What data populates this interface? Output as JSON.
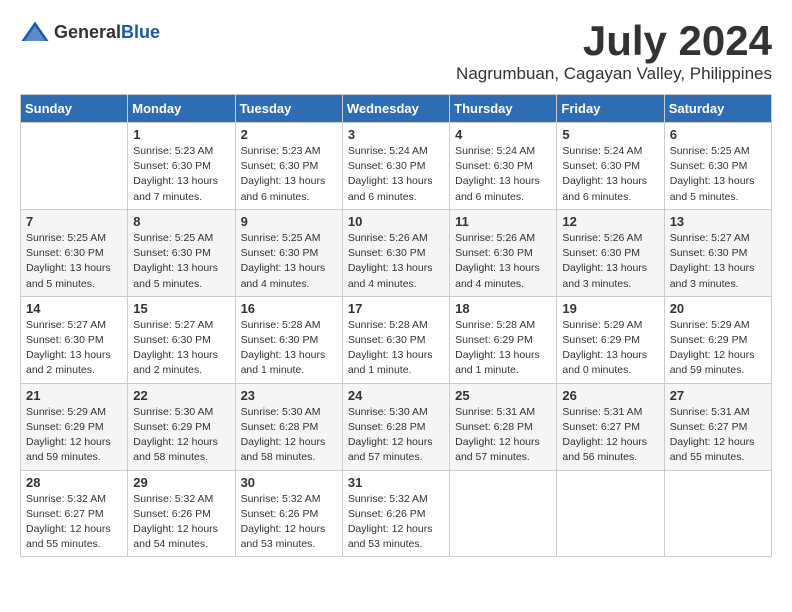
{
  "logo": {
    "general": "General",
    "blue": "Blue"
  },
  "title": {
    "month": "July 2024",
    "location": "Nagrumbuan, Cagayan Valley, Philippines"
  },
  "calendar": {
    "headers": [
      "Sunday",
      "Monday",
      "Tuesday",
      "Wednesday",
      "Thursday",
      "Friday",
      "Saturday"
    ],
    "rows": [
      [
        {
          "date": "",
          "info": ""
        },
        {
          "date": "1",
          "info": "Sunrise: 5:23 AM\nSunset: 6:30 PM\nDaylight: 13 hours\nand 7 minutes."
        },
        {
          "date": "2",
          "info": "Sunrise: 5:23 AM\nSunset: 6:30 PM\nDaylight: 13 hours\nand 6 minutes."
        },
        {
          "date": "3",
          "info": "Sunrise: 5:24 AM\nSunset: 6:30 PM\nDaylight: 13 hours\nand 6 minutes."
        },
        {
          "date": "4",
          "info": "Sunrise: 5:24 AM\nSunset: 6:30 PM\nDaylight: 13 hours\nand 6 minutes."
        },
        {
          "date": "5",
          "info": "Sunrise: 5:24 AM\nSunset: 6:30 PM\nDaylight: 13 hours\nand 6 minutes."
        },
        {
          "date": "6",
          "info": "Sunrise: 5:25 AM\nSunset: 6:30 PM\nDaylight: 13 hours\nand 5 minutes."
        }
      ],
      [
        {
          "date": "7",
          "info": "Sunrise: 5:25 AM\nSunset: 6:30 PM\nDaylight: 13 hours\nand 5 minutes."
        },
        {
          "date": "8",
          "info": "Sunrise: 5:25 AM\nSunset: 6:30 PM\nDaylight: 13 hours\nand 5 minutes."
        },
        {
          "date": "9",
          "info": "Sunrise: 5:25 AM\nSunset: 6:30 PM\nDaylight: 13 hours\nand 4 minutes."
        },
        {
          "date": "10",
          "info": "Sunrise: 5:26 AM\nSunset: 6:30 PM\nDaylight: 13 hours\nand 4 minutes."
        },
        {
          "date": "11",
          "info": "Sunrise: 5:26 AM\nSunset: 6:30 PM\nDaylight: 13 hours\nand 4 minutes."
        },
        {
          "date": "12",
          "info": "Sunrise: 5:26 AM\nSunset: 6:30 PM\nDaylight: 13 hours\nand 3 minutes."
        },
        {
          "date": "13",
          "info": "Sunrise: 5:27 AM\nSunset: 6:30 PM\nDaylight: 13 hours\nand 3 minutes."
        }
      ],
      [
        {
          "date": "14",
          "info": "Sunrise: 5:27 AM\nSunset: 6:30 PM\nDaylight: 13 hours\nand 2 minutes."
        },
        {
          "date": "15",
          "info": "Sunrise: 5:27 AM\nSunset: 6:30 PM\nDaylight: 13 hours\nand 2 minutes."
        },
        {
          "date": "16",
          "info": "Sunrise: 5:28 AM\nSunset: 6:30 PM\nDaylight: 13 hours\nand 1 minute."
        },
        {
          "date": "17",
          "info": "Sunrise: 5:28 AM\nSunset: 6:30 PM\nDaylight: 13 hours\nand 1 minute."
        },
        {
          "date": "18",
          "info": "Sunrise: 5:28 AM\nSunset: 6:29 PM\nDaylight: 13 hours\nand 1 minute."
        },
        {
          "date": "19",
          "info": "Sunrise: 5:29 AM\nSunset: 6:29 PM\nDaylight: 13 hours\nand 0 minutes."
        },
        {
          "date": "20",
          "info": "Sunrise: 5:29 AM\nSunset: 6:29 PM\nDaylight: 12 hours\nand 59 minutes."
        }
      ],
      [
        {
          "date": "21",
          "info": "Sunrise: 5:29 AM\nSunset: 6:29 PM\nDaylight: 12 hours\nand 59 minutes."
        },
        {
          "date": "22",
          "info": "Sunrise: 5:30 AM\nSunset: 6:29 PM\nDaylight: 12 hours\nand 58 minutes."
        },
        {
          "date": "23",
          "info": "Sunrise: 5:30 AM\nSunset: 6:28 PM\nDaylight: 12 hours\nand 58 minutes."
        },
        {
          "date": "24",
          "info": "Sunrise: 5:30 AM\nSunset: 6:28 PM\nDaylight: 12 hours\nand 57 minutes."
        },
        {
          "date": "25",
          "info": "Sunrise: 5:31 AM\nSunset: 6:28 PM\nDaylight: 12 hours\nand 57 minutes."
        },
        {
          "date": "26",
          "info": "Sunrise: 5:31 AM\nSunset: 6:27 PM\nDaylight: 12 hours\nand 56 minutes."
        },
        {
          "date": "27",
          "info": "Sunrise: 5:31 AM\nSunset: 6:27 PM\nDaylight: 12 hours\nand 55 minutes."
        }
      ],
      [
        {
          "date": "28",
          "info": "Sunrise: 5:32 AM\nSunset: 6:27 PM\nDaylight: 12 hours\nand 55 minutes."
        },
        {
          "date": "29",
          "info": "Sunrise: 5:32 AM\nSunset: 6:26 PM\nDaylight: 12 hours\nand 54 minutes."
        },
        {
          "date": "30",
          "info": "Sunrise: 5:32 AM\nSunset: 6:26 PM\nDaylight: 12 hours\nand 53 minutes."
        },
        {
          "date": "31",
          "info": "Sunrise: 5:32 AM\nSunset: 6:26 PM\nDaylight: 12 hours\nand 53 minutes."
        },
        {
          "date": "",
          "info": ""
        },
        {
          "date": "",
          "info": ""
        },
        {
          "date": "",
          "info": ""
        }
      ]
    ]
  }
}
